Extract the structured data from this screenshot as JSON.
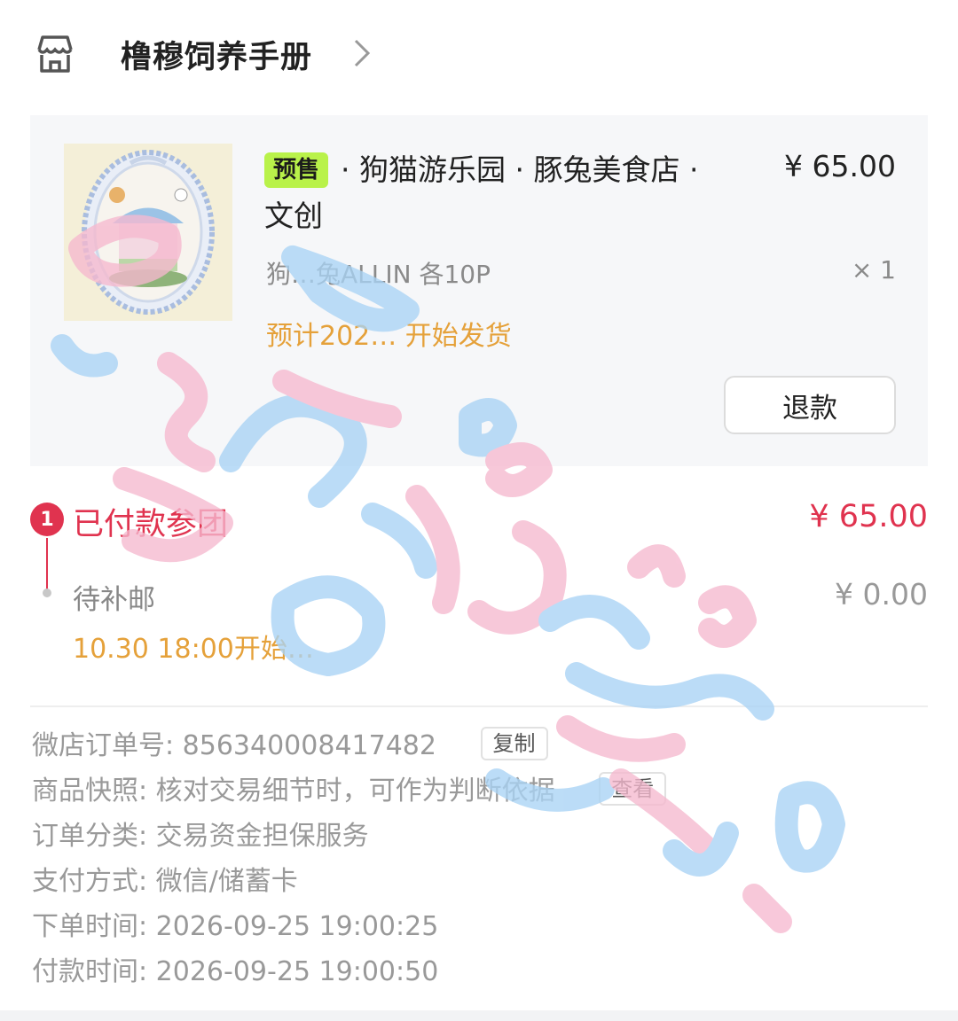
{
  "shop": {
    "name": "橹穆饲养手册",
    "icon": "shop-icon",
    "chevron": "chevron-right-icon"
  },
  "item": {
    "tag": "预售",
    "title": "· 狗猫游乐园 · 豚兔美食店 · 文创",
    "price": "¥ 65.00",
    "variant": "狗…兔ALLIN 各10P",
    "quantity": "× 1",
    "ship_note": "预计202… 开始发货",
    "refund_label": "退款",
    "tag_color": "#b9f24a"
  },
  "timeline": {
    "step1_number": "1",
    "step1_label": "已付款参团",
    "step1_amount": "¥ 65.00",
    "step2_label": "待补邮",
    "step2_amount": "¥ 0.00",
    "step2_note": "10.30 18:00开始…",
    "accent_color": "#e0334f"
  },
  "order": {
    "order_no_label": "微店订单号:",
    "order_no": "856340008417482",
    "copy_label": "复制",
    "snapshot_label": "商品快照:",
    "snapshot_text": "核对交易细节时，可作为判断依据",
    "view_label": "查看",
    "category_label": "订单分类:",
    "category": "交易资金担保服务",
    "pay_method_label": "支付方式:",
    "pay_method": "微信/储蓄卡",
    "order_time_label": "下单时间:",
    "order_time": "2026-09-25 19:00:25",
    "pay_time_label": "付款时间:",
    "pay_time": "2026-09-25 19:00:50"
  }
}
